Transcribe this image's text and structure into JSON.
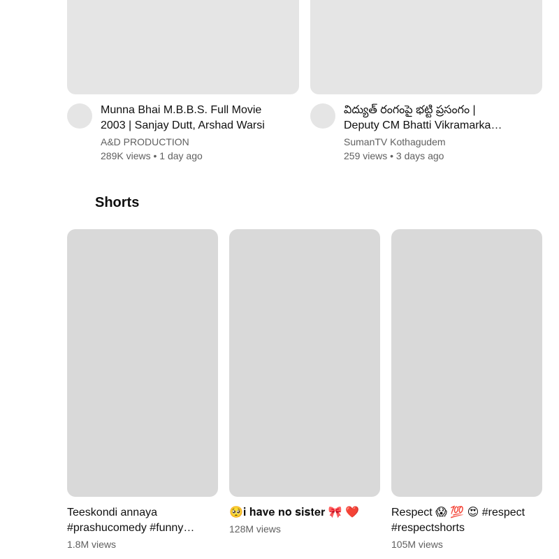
{
  "videos": [
    {
      "title": "Munna Bhai M.B.B.S. Full Movie 2003 | Sanjay Dutt, Arshad Warsi",
      "channel": "A&D PRODUCTION",
      "stats": "289K views • 1 day ago"
    },
    {
      "title": "విద్యుత్ రంగంపై భట్టి ప్రసంగం | Deputy CM Bhatti Vikramarka Speech",
      "channel": "SumanTV Kothagudem",
      "stats": "259 views • 3 days ago"
    }
  ],
  "shorts": {
    "header": "Shorts",
    "items": [
      {
        "title": "Teeskondi annaya #prashucomedy #funny #comedy",
        "views": "1.8M views"
      },
      {
        "title": "🥺𝐢 𝐡𝐚𝐯𝐞 𝐧𝐨 𝐬𝐢𝐬𝐭𝐞𝐫 🎀 ❤️",
        "views": "128M views"
      },
      {
        "title": "Respect 😱 💯 😍 #respect #respectshorts",
        "views": "105M views"
      }
    ]
  }
}
